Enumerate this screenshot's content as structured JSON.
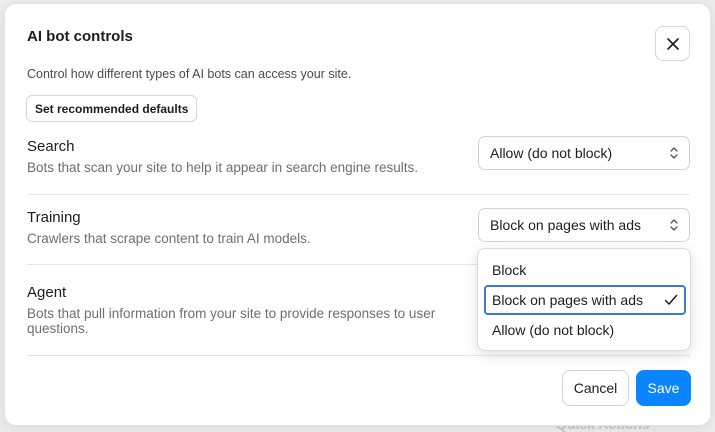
{
  "background": {
    "hint_text": "Quick Actions"
  },
  "dialog": {
    "title": "AI bot controls",
    "subtitle": "Control how different types of AI bots can access your site.",
    "defaults_button": "Set recommended defaults",
    "close_icon": "close-icon"
  },
  "rows": [
    {
      "title": "Search",
      "description": "Bots that scan your site to help it appear in search engine results.",
      "value": "Allow (do not block)"
    },
    {
      "title": "Training",
      "description": "Crawlers that scrape content to train AI models.",
      "value": "Block on pages with ads"
    },
    {
      "title": "Agent",
      "description": "Bots that pull information from your site to provide responses to user questions."
    }
  ],
  "dropdown": {
    "options": [
      "Block",
      "Block on pages with ads",
      "Allow (do not block)"
    ],
    "selected": "Block on pages with ads"
  },
  "footer": {
    "cancel_label": "Cancel",
    "save_label": "Save"
  },
  "colors": {
    "accent": "#0a84ff",
    "focus": "#3a7bd5"
  }
}
